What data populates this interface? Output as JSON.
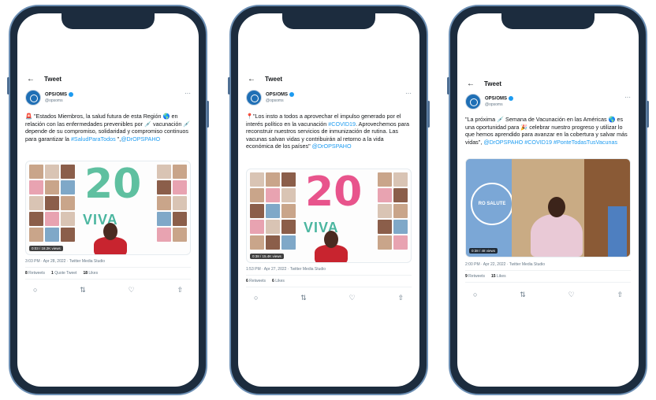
{
  "header": {
    "back": "←",
    "title": "Tweet"
  },
  "author": {
    "name": "OPS/OMS",
    "handle": "@opsoms",
    "more": "···"
  },
  "tweets": [
    {
      "text_parts": [
        "🚨 \"Estados Miembros, la salud futura de esta Región 🌎 en relación con las enfermedades prevenibles por 💉 vacunación 💉 depende de su compromiso, solidaridad y compromiso continuos para garantizar la ",
        "#SaludParaTodos",
        " \",",
        "@DrOPSPAHO"
      ],
      "media_badge": "0:03 / 18.2K views",
      "media_logo": "20",
      "media_viva": "VIVA",
      "time": "3:03 PM · Apr 28, 2022 · Twitter Media Studio",
      "stats": [
        {
          "num": "8",
          "label": "Retweets"
        },
        {
          "num": "1",
          "label": "Quote Tweet"
        },
        {
          "num": "18",
          "label": "Likes"
        }
      ]
    },
    {
      "text_parts": [
        "📍\"Los insto a todos a aprovechar el impulso generado por el interés político en la vacunación ",
        "#COVID19",
        ". Aprovechemos para reconstruir nuestros servicios de inmunización de rutina. Las vacunas salvan vidas y contribuirán al retorno a la vida económica de los países\" ",
        "@DrOPSPAHO"
      ],
      "media_badge": "0:38 / 15.4K views",
      "media_logo": "20",
      "media_viva": "VIVA",
      "time": "1:53 PM · Apr 27, 2022 · Twitter Media Studio",
      "stats": [
        {
          "num": "6",
          "label": "Retweets"
        },
        {
          "num": "6",
          "label": "Likes"
        }
      ]
    },
    {
      "text_parts": [
        "\"La próxima 💉 Semana de Vacunación en las Américas 🌎 es una oportunidad para 🎉 celebrar nuestro progreso y utilizar lo que hemos aprendido para avanzar en la cobertura y salvar más vidas\", ",
        "@DrOPSPAHO #COVID19 #PonteTodasTusVacunas"
      ],
      "media_badge": "0:38 / 48 views",
      "media_seal": "RO SALUTE",
      "time": "2:00 PM · Apr 22, 2022 · Twitter Media Studio",
      "stats": [
        {
          "num": "9",
          "label": "Retweets"
        },
        {
          "num": "15",
          "label": "Likes"
        }
      ]
    }
  ],
  "actions": {
    "reply": "♡",
    "retweet": "⇅",
    "like": "♡",
    "share": "⇧"
  },
  "colors": {
    "frame": "#1c2c3e",
    "frame_edge": "#6c8fb4",
    "link": "#1d9bf0",
    "speaker_red": "#c8242f"
  }
}
